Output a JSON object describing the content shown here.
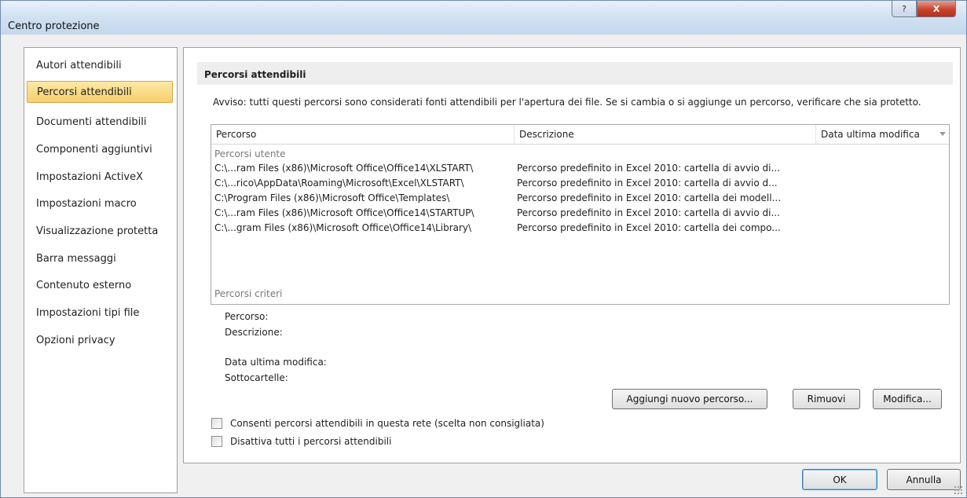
{
  "window": {
    "title": "Centro protezione"
  },
  "titlebar_buttons": {
    "help": "?",
    "close": "X"
  },
  "nav": {
    "items": [
      "Autori attendibili",
      "Percorsi attendibili",
      "Documenti attendibili",
      "Componenti aggiuntivi",
      "Impostazioni ActiveX",
      "Impostazioni macro",
      "Visualizzazione protetta",
      "Barra messaggi",
      "Contenuto esterno",
      "Impostazioni tipi file",
      "Opzioni privacy"
    ],
    "selected": "Percorsi attendibili"
  },
  "section": {
    "header": "Percorsi attendibili",
    "warning": "Avviso: tutti questi percorsi sono considerati fonti attendibili per l'apertura dei file. Se si cambia o si aggiunge un percorso, verificare che sia protetto."
  },
  "grid": {
    "columns": [
      "Percorso",
      "Descrizione",
      "Data ultima modifica"
    ],
    "group_user": "Percorsi utente",
    "group_policy": "Percorsi criteri",
    "rows": [
      {
        "path": "C:\\...ram Files (x86)\\Microsoft Office\\Office14\\XLSTART\\",
        "desc": "Percorso predefinito in Excel 2010: cartella di avvio di...",
        "date": ""
      },
      {
        "path": "C:\\...rico\\AppData\\Roaming\\Microsoft\\Excel\\XLSTART\\",
        "desc": "Percorso predefinito in Excel 2010: cartella di avvio d...",
        "date": ""
      },
      {
        "path": "C:\\Program Files (x86)\\Microsoft Office\\Templates\\",
        "desc": "Percorso predefinito in Excel 2010: cartella dei modell...",
        "date": ""
      },
      {
        "path": "C:\\...ram Files (x86)\\Microsoft Office\\Office14\\STARTUP\\",
        "desc": "Percorso predefinito in Excel 2010: cartella di avvio di...",
        "date": ""
      },
      {
        "path": "C:\\...gram Files (x86)\\Microsoft Office\\Office14\\Library\\",
        "desc": "Percorso predefinito in Excel 2010: cartella dei compo...",
        "date": ""
      }
    ]
  },
  "details": {
    "path_label": "Percorso:",
    "desc_label": "Descrizione:",
    "date_label": "Data ultima modifica:",
    "subfolders_label": "Sottocartelle:"
  },
  "actions": {
    "add": "Aggiungi nuovo percorso...",
    "remove": "Rimuovi",
    "modify": "Modifica..."
  },
  "options": {
    "allow_network": {
      "label": "Consenti percorsi attendibili in questa rete (scelta non consigliata)",
      "checked": false
    },
    "disable_all": {
      "label": "Disattiva tutti i percorsi attendibili",
      "checked": false
    }
  },
  "footer": {
    "ok": "OK",
    "cancel": "Annulla"
  }
}
